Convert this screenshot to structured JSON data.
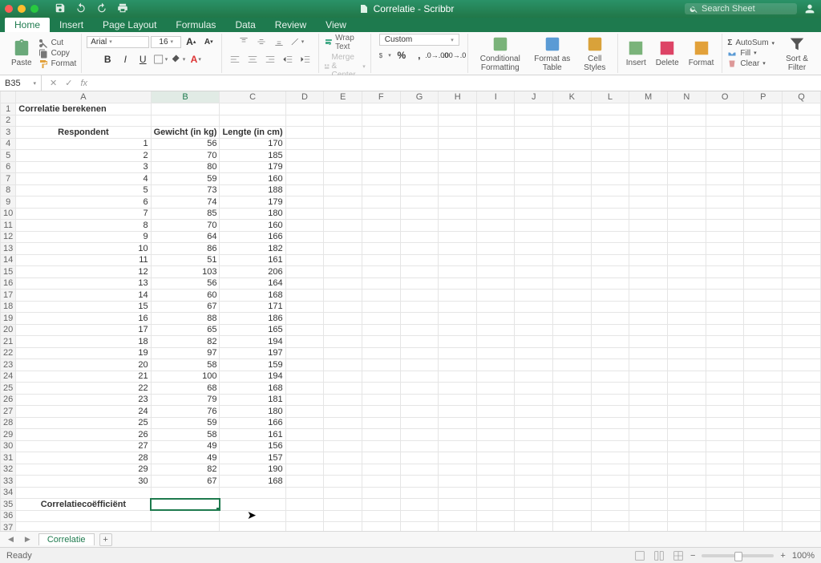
{
  "app": {
    "title": "Correlatie - Scribbr",
    "search_placeholder": "Search Sheet"
  },
  "tabs": [
    "Home",
    "Insert",
    "Page Layout",
    "Formulas",
    "Data",
    "Review",
    "View"
  ],
  "active_tab": "Home",
  "clipboard": {
    "paste": "Paste",
    "cut": "Cut",
    "copy": "Copy",
    "format": "Format"
  },
  "font": {
    "name": "Arial",
    "size": "16"
  },
  "alignment": {
    "wrap": "Wrap Text",
    "merge": "Merge & Center"
  },
  "number": {
    "format": "Custom"
  },
  "styles": {
    "cond": "Conditional Formatting",
    "table": "Format as Table",
    "cell": "Cell Styles"
  },
  "cells": {
    "insert": "Insert",
    "delete": "Delete",
    "format": "Format"
  },
  "editing": {
    "autosum": "AutoSum",
    "fill": "Fill",
    "clear": "Clear",
    "sort": "Sort & Filter"
  },
  "namebox": "B35",
  "formula": "",
  "columns": [
    "A",
    "B",
    "C",
    "D",
    "E",
    "F",
    "G",
    "H",
    "I",
    "J",
    "K",
    "L",
    "M",
    "N",
    "O",
    "P",
    "Q"
  ],
  "col_widths": {
    "A": 172,
    "B": 80,
    "C": 80,
    "default": 50
  },
  "selected_col": "B",
  "selected_cell": {
    "row": 35,
    "col": "B"
  },
  "sheet_tab": "Correlatie",
  "status_text": "Ready",
  "zoom": "100%",
  "headers": {
    "title": "Correlatie berekenen",
    "respondent": "Respondent",
    "gewicht": "Gewicht (in kg)",
    "lengte": "Lengte (in cm)",
    "coef": "Correlatiecoëfficiënt"
  },
  "data_rows": [
    {
      "r": 1,
      "g": 56,
      "l": 170
    },
    {
      "r": 2,
      "g": 70,
      "l": 185
    },
    {
      "r": 3,
      "g": 80,
      "l": 179
    },
    {
      "r": 4,
      "g": 59,
      "l": 160
    },
    {
      "r": 5,
      "g": 73,
      "l": 188
    },
    {
      "r": 6,
      "g": 74,
      "l": 179
    },
    {
      "r": 7,
      "g": 85,
      "l": 180
    },
    {
      "r": 8,
      "g": 70,
      "l": 160
    },
    {
      "r": 9,
      "g": 64,
      "l": 166
    },
    {
      "r": 10,
      "g": 86,
      "l": 182
    },
    {
      "r": 11,
      "g": 51,
      "l": 161
    },
    {
      "r": 12,
      "g": 103,
      "l": 206
    },
    {
      "r": 13,
      "g": 56,
      "l": 164
    },
    {
      "r": 14,
      "g": 60,
      "l": 168
    },
    {
      "r": 15,
      "g": 67,
      "l": 171
    },
    {
      "r": 16,
      "g": 88,
      "l": 186
    },
    {
      "r": 17,
      "g": 65,
      "l": 165
    },
    {
      "r": 18,
      "g": 82,
      "l": 194
    },
    {
      "r": 19,
      "g": 97,
      "l": 197
    },
    {
      "r": 20,
      "g": 58,
      "l": 159
    },
    {
      "r": 21,
      "g": 100,
      "l": 194
    },
    {
      "r": 22,
      "g": 68,
      "l": 168
    },
    {
      "r": 23,
      "g": 79,
      "l": 181
    },
    {
      "r": 24,
      "g": 76,
      "l": 180
    },
    {
      "r": 25,
      "g": 59,
      "l": 166
    },
    {
      "r": 26,
      "g": 58,
      "l": 161
    },
    {
      "r": 27,
      "g": 49,
      "l": 156
    },
    {
      "r": 28,
      "g": 49,
      "l": 157
    },
    {
      "r": 29,
      "g": 82,
      "l": 190
    },
    {
      "r": 30,
      "g": 67,
      "l": 168
    }
  ],
  "total_rows": 37
}
